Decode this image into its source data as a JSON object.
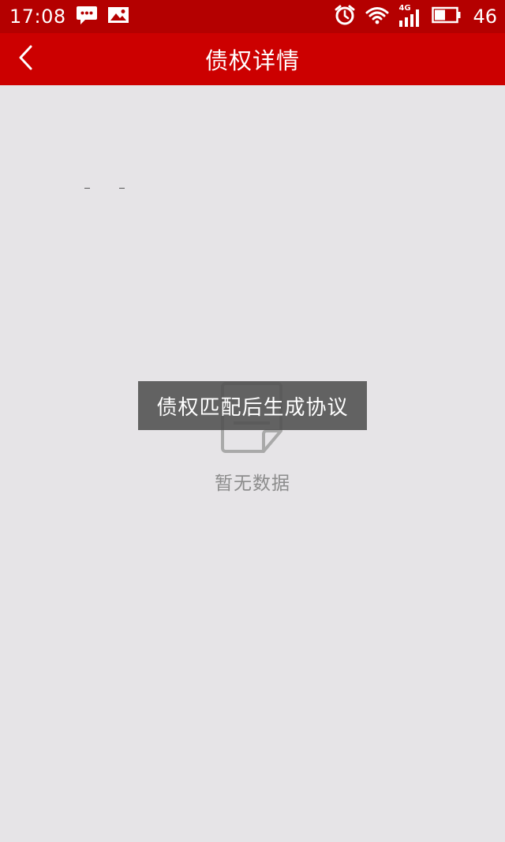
{
  "status_bar": {
    "time": "17:08",
    "network_label": "4G",
    "battery_percent": "46",
    "icons": [
      "message-icon",
      "image-icon",
      "alarm-icon",
      "wifi-icon",
      "signal-icon",
      "battery-icon"
    ]
  },
  "header": {
    "title": "债权详情",
    "back_icon": "chevron-left-icon"
  },
  "empty_state": {
    "icon": "document-icon",
    "text": "暂无数据"
  },
  "toast": {
    "text": "债权匹配后生成协议"
  },
  "colors": {
    "status_bar": "#b40000",
    "header": "#cc0000",
    "background": "#e6e4e7",
    "toast_background": "#505050",
    "empty_text": "#8c8c8c"
  }
}
